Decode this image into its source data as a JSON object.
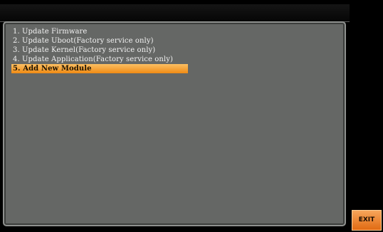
{
  "menu": {
    "items": [
      {
        "label": "1. Update Firmware"
      },
      {
        "label": "2. Update Uboot(Factory service only)"
      },
      {
        "label": "3. Update Kernel(Factory service only)"
      },
      {
        "label": "4. Update Application(Factory service only)"
      },
      {
        "label": "5. Add New Module"
      }
    ],
    "selected_index": 4
  },
  "softkeys": {
    "exit_label": "EXIT"
  },
  "colors": {
    "panel_background": "#656765",
    "selection_highlight": "#f5a033",
    "softkey_accent": "#ee8530"
  }
}
